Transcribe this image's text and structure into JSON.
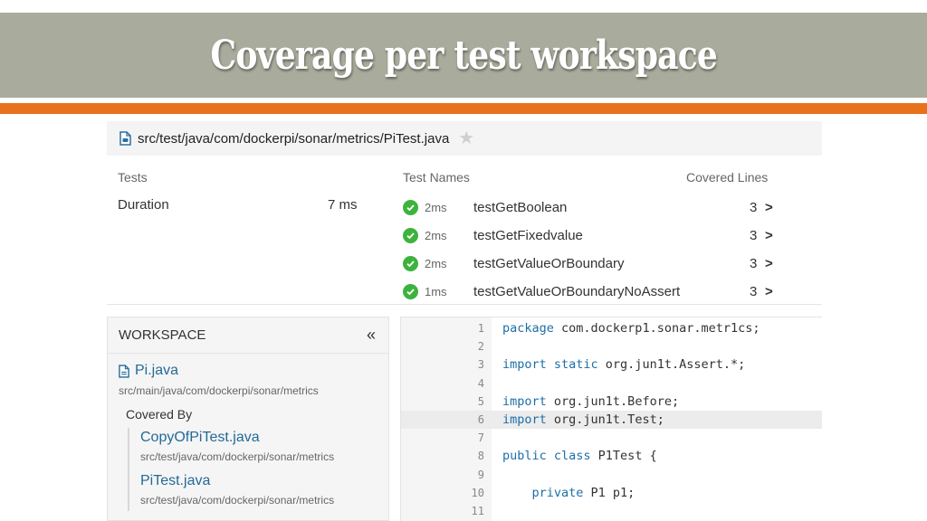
{
  "slide": {
    "title": "Coverage per test workspace"
  },
  "file_bar": {
    "path": "src/test/java/com/dockerpi/sonar/metrics/PiTest.java",
    "icon": "file-icon",
    "favorite_icon": "star-icon"
  },
  "summary": {
    "tests_label": "Tests",
    "duration_label": "Duration",
    "duration_value": "7 ms",
    "test_names_header": "Test Names",
    "covered_lines_header": "Covered Lines",
    "tests": [
      {
        "status": "passed",
        "duration": "2ms",
        "name": "testGetBoolean",
        "covered": "3"
      },
      {
        "status": "passed",
        "duration": "2ms",
        "name": "testGetFixedvalue",
        "covered": "3"
      },
      {
        "status": "passed",
        "duration": "2ms",
        "name": "testGetValueOrBoundary",
        "covered": "3"
      },
      {
        "status": "passed",
        "duration": "1ms",
        "name": "testGetValueOrBoundaryNoAssert",
        "covered": "3"
      }
    ]
  },
  "workspace": {
    "title": "WORKSPACE",
    "collapse_glyph": "«",
    "file_name": "Pi.java",
    "file_path": "src/main/java/com/dockerpi/sonar/metrics",
    "covered_by_label": "Covered By",
    "covered_by": [
      {
        "name": "CopyOfPiTest.java",
        "path": "src/test/java/com/dockerpi/sonar/metrics"
      },
      {
        "name": "PiTest.java",
        "path": "src/test/java/com/dockerpi/sonar/metrics"
      }
    ]
  },
  "code": {
    "highlighted_line": 6,
    "lines": [
      {
        "n": "1",
        "kw": "package",
        "rest": " com.dockerp1.sonar.metr1cs;"
      },
      {
        "n": "2",
        "kw": "",
        "rest": ""
      },
      {
        "n": "3",
        "kw": "import static",
        "rest": " org.jun1t.Assert.*;"
      },
      {
        "n": "4",
        "kw": "",
        "rest": ""
      },
      {
        "n": "5",
        "kw": "import",
        "rest": " org.jun1t.Before;"
      },
      {
        "n": "6",
        "kw": "import",
        "rest": " org.jun1t.Test;"
      },
      {
        "n": "7",
        "kw": "",
        "rest": ""
      },
      {
        "n": "8",
        "kw": "public class",
        "rest": " P1Test {"
      },
      {
        "n": "9",
        "kw": "",
        "rest": ""
      },
      {
        "n": "10",
        "kw": "    private",
        "rest": " P1 p1;"
      },
      {
        "n": "11",
        "kw": "",
        "rest": ""
      }
    ]
  },
  "colors": {
    "title_band": "#a9ab9c",
    "accent_orange": "#e8711c",
    "link_blue": "#236a97",
    "pass_green": "#3db33d",
    "keyword_blue": "#1d6fa8"
  }
}
